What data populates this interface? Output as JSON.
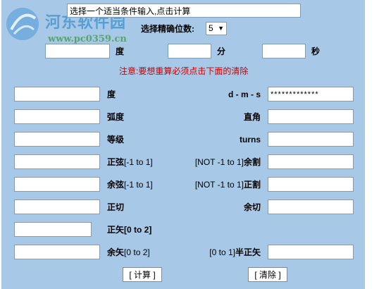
{
  "watermark": {
    "title": "河东软件园",
    "url": "www.pc0359.cn"
  },
  "header": {
    "instruction_value": "选择一个适当条件输入,点击计算",
    "precision_label": "选择精确位数:",
    "precision_selected": "5",
    "precision_arrow": "▼"
  },
  "dms": {
    "deg_label": "度",
    "min_label": "分",
    "sec_label": "秒"
  },
  "note": "注意:要想重算必须点击下面的清除",
  "rows": {
    "degree": "度",
    "dms": "d - m - s",
    "dms_value": "*************",
    "radian": "弧度",
    "right_angle": "直角",
    "grade": "等级",
    "turns": "turns",
    "sine": "正弦",
    "sine_range": "[-1 to 1]",
    "cosecant_range": "[NOT -1 to 1]",
    "cosecant": "余割",
    "cosine": "余弦",
    "cosine_range": "[-1 to 1]",
    "secant_range": "[NOT -1 to 1]",
    "secant": "正割",
    "tangent": "正切",
    "cotangent": "余切",
    "versine": "正矢[0 to 2]",
    "coversine": "余矢",
    "coversine_range": "[0 to 2]",
    "haversine_range": "[0 to 1]",
    "haversine": "半正矢"
  },
  "buttons": {
    "calculate": "[ 计算 ]",
    "clear": "[ 清除 ]"
  },
  "colors": {
    "background": "#a7c8e6",
    "note": "#cc0000",
    "border": "#7f9db9"
  }
}
